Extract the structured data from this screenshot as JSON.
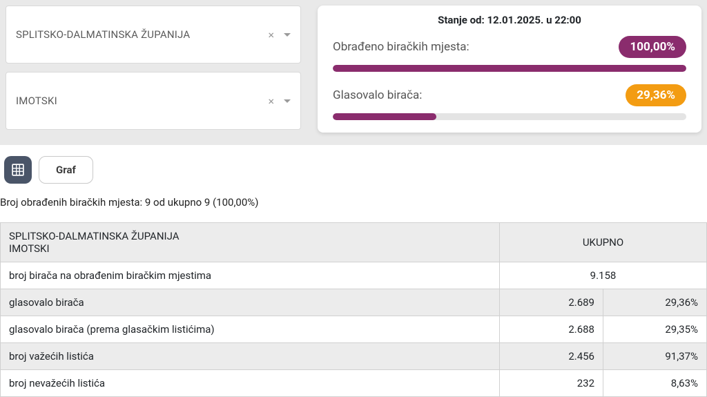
{
  "filters": {
    "region": "SPLITSKO-DALMATINSKA ŽUPANIJA",
    "municipality": "IMOTSKI"
  },
  "status": {
    "header": "Stanje od: 12.01.2025. u 22:00",
    "processed": {
      "label": "Obrađeno biračkih mjesta:",
      "value": "100,00%",
      "percent": 100
    },
    "turnout": {
      "label": "Glasovalo birača:",
      "value": "29,36%",
      "percent": 29.36
    }
  },
  "tabs": {
    "graph": "Graf"
  },
  "summary": "Broj obrađenih biračkih mjesta: 9 od ukupno 9 (100,00%)",
  "table": {
    "header": {
      "region": "SPLITSKO-DALMATINSKA ŽUPANIJA",
      "municipality": "IMOTSKI",
      "total": "UKUPNO"
    },
    "rows": [
      {
        "label": "broj birača na obrađenim biračkim mjestima",
        "v1": "9.158",
        "v2": null
      },
      {
        "label": "glasovalo birača",
        "v1": "2.689",
        "v2": "29,36%"
      },
      {
        "label": "glasovalo birača (prema glasačkim listićima)",
        "v1": "2.688",
        "v2": "29,35%"
      },
      {
        "label": "broj važećih listića",
        "v1": "2.456",
        "v2": "91,37%"
      },
      {
        "label": "broj nevažećih listića",
        "v1": "232",
        "v2": "8,63%"
      }
    ]
  }
}
